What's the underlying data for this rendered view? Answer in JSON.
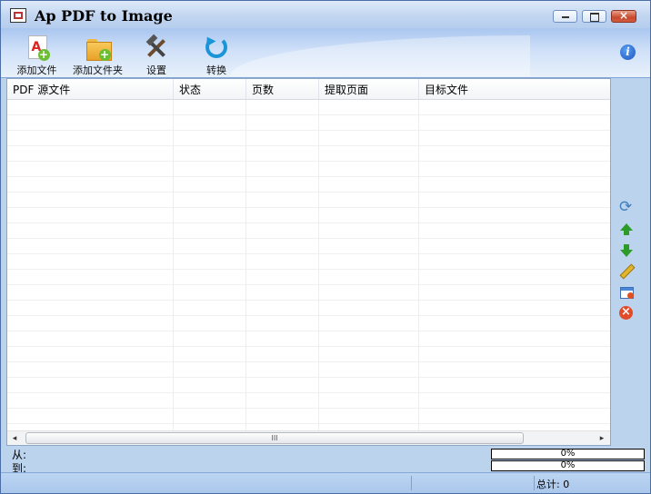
{
  "window": {
    "title": "Ap PDF to Image"
  },
  "title_buttons": {
    "close_glyph": "×"
  },
  "toolbar": {
    "add_file": "添加文件",
    "add_folder": "添加文件夹",
    "settings": "设置",
    "convert": "转换",
    "info_glyph": "i",
    "pdf_glyph": "A",
    "plus_glyph": "+"
  },
  "table": {
    "columns": [
      "PDF 源文件",
      "状态",
      "页数",
      "提取页面",
      "目标文件"
    ],
    "rows": []
  },
  "scroll": {
    "left": "◂",
    "right": "▸",
    "thumb": "III"
  },
  "progress": {
    "from_label": "从:",
    "to_label": "到:",
    "from_value": 0,
    "to_value": 0,
    "from_text": "0%",
    "to_text": "0%"
  },
  "status": {
    "total": "总计: 0"
  },
  "colors": {
    "accent": "#3d7fd1",
    "toolbar": "#cfe0f8",
    "status": "#bcd5f2"
  },
  "icons": {
    "app": "app-icon",
    "add_file": "pdf-add-icon",
    "add_folder": "folder-add-icon",
    "settings": "tools-icon",
    "convert": "convert-icon",
    "side": [
      "refresh-icon",
      "arrow-up-icon",
      "arrow-down-icon",
      "pencil-icon",
      "window-icon",
      "delete-icon"
    ]
  }
}
